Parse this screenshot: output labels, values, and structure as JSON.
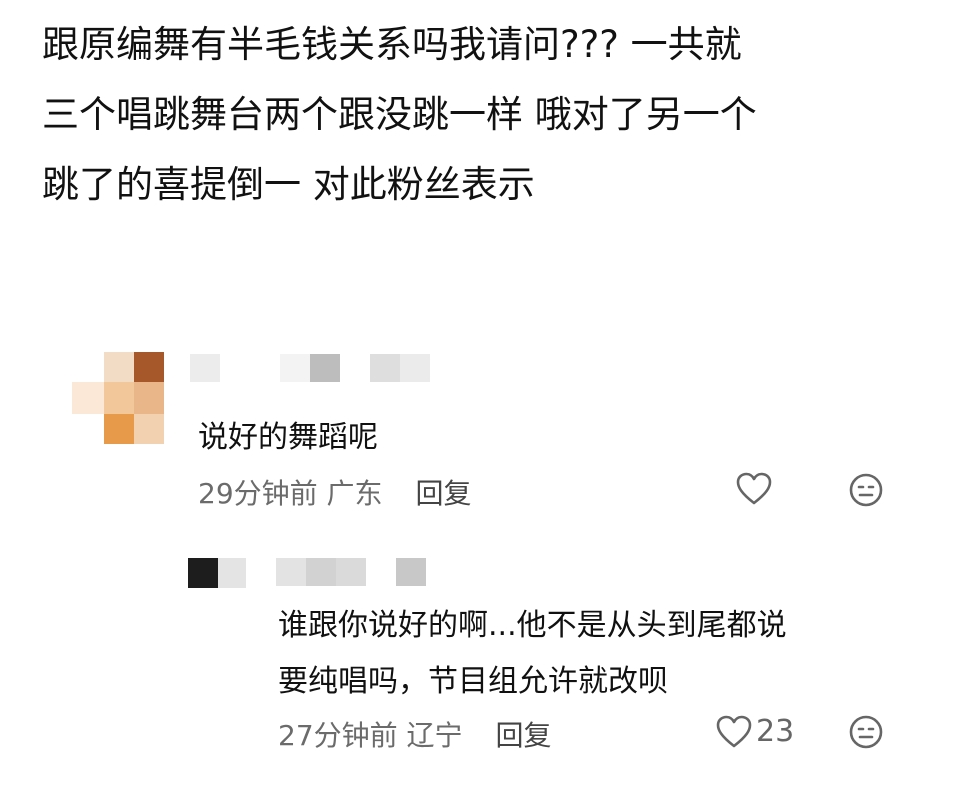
{
  "post": {
    "lines": [
      "跟原编舞有半毛钱关系吗我请问??? 一共就",
      "三个唱跳舞台两个跟没跳一样 哦对了另一个",
      "跳了的喜提倒一 对此粉丝表示"
    ]
  },
  "comments": [
    {
      "text": "说好的舞蹈呢",
      "time": "29分钟前",
      "location": "广东",
      "reply_label": "回复",
      "like_count": "",
      "like_icon": "heart-outline-icon",
      "emoji_icon": "emoji-face-icon"
    },
    {
      "text_lines": [
        "谁跟你说好的啊...他不是从头到尾都说",
        "要纯唱吗，节目组允许就改呗"
      ],
      "time": "27分钟前",
      "location": "辽宁",
      "reply_label": "回复",
      "like_count": "23",
      "like_icon": "heart-outline-icon",
      "emoji_icon": "emoji-face-icon"
    }
  ],
  "colors": {
    "meta": "#6b6b6b",
    "text": "#111111",
    "icon": "#666666"
  }
}
